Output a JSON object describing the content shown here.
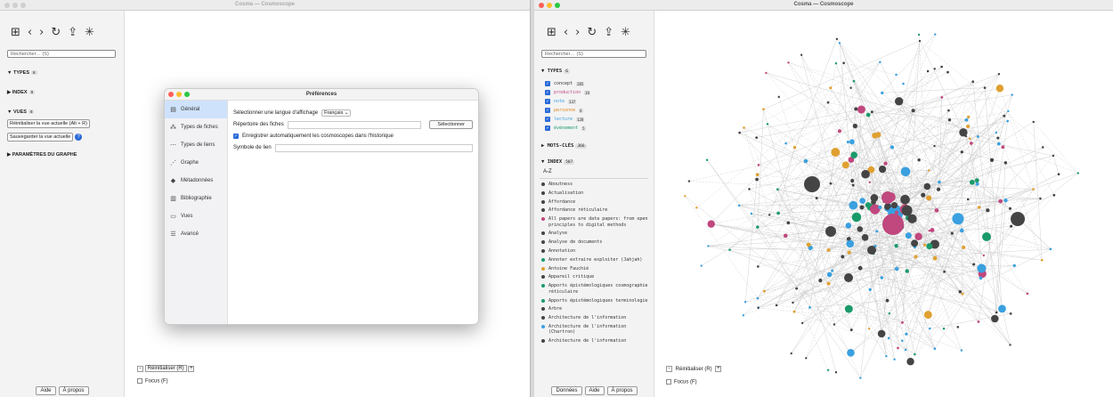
{
  "left_window": {
    "title": "Cosma — Cosmoscope",
    "toolbar_icons": [
      "new-record-icon",
      "back-icon",
      "forward-icon",
      "reload-icon",
      "share-icon",
      "asterisk-icon"
    ],
    "toolbar_glyphs": [
      "⊞",
      "‹",
      "›",
      "↻",
      "⇪",
      "✳"
    ],
    "search_placeholder": "Rechercher… (S)",
    "types_label": "TYPES",
    "types_badge": "8",
    "index_label": "INDEX",
    "index_badge": "8",
    "vues_label": "VUES",
    "vues_badge": "8",
    "reset_view_button": "Réinitialiser la vue actuelle (Alt + R)",
    "save_view_button": "Sauvegarder la vue actuelle",
    "help_mark": "?",
    "graph_params_label": "PARAMÈTRES DU GRAPHE",
    "zoom_minus": "-",
    "zoom_reset": "Réinitialiser (R)",
    "zoom_plus": "+",
    "focus_label": "Focus (F)",
    "help_button": "Aide",
    "about_button": "À propos"
  },
  "dialog": {
    "title": "Préférences",
    "nav": [
      {
        "label": "Général",
        "icon": "▤"
      },
      {
        "label": "Types de fiches",
        "icon": "⁂"
      },
      {
        "label": "Types de liens",
        "icon": "⋯"
      },
      {
        "label": "Graphe",
        "icon": "⋰"
      },
      {
        "label": "Métadonnées",
        "icon": "◆"
      },
      {
        "label": "Bibliographie",
        "icon": "▥"
      },
      {
        "label": "Vues",
        "icon": "▭"
      },
      {
        "label": "Avancé",
        "icon": "☰"
      }
    ],
    "language_label": "Sélectionner une langue d'affichage",
    "language_value": "Français",
    "repo_label": "Répertoire des fiches",
    "select_button": "Sélectionner",
    "autosave_label": "Enregistrer automatiquement les cosmoscopes dans l'historique",
    "link_symbol_label": "Symbole de lien"
  },
  "right_window": {
    "title": "Cosma — Cosmoscope",
    "search_placeholder": "Rechercher… (S)",
    "types_label": "TYPES",
    "types_badge": "6",
    "types": [
      {
        "name": "concept",
        "count": "285",
        "color": "#333333"
      },
      {
        "name": "production",
        "count": "19",
        "color": "#c0487e"
      },
      {
        "name": "note",
        "count": "137",
        "color": "#3aa0e0"
      },
      {
        "name": "personne",
        "count": "6",
        "color": "#e08a20"
      },
      {
        "name": "lecture",
        "count": "128",
        "color": "#3aa0e0"
      },
      {
        "name": "événement",
        "count": "5",
        "color": "#1a9a6a"
      }
    ],
    "keywords_label": "MOTS-CLÉS",
    "keywords_badge": "366",
    "index_label": "INDEX",
    "index_badge": "587",
    "az_label": "A-Z",
    "index_items": [
      {
        "label": "Aboutness",
        "color": "#444444"
      },
      {
        "label": "Actualisation",
        "color": "#444444"
      },
      {
        "label": "Affordance",
        "color": "#444444"
      },
      {
        "label": "Affordance réticulaire",
        "color": "#444444"
      },
      {
        "label": "All papers are data papers: from open principles to digital methods",
        "color": "#c0487e"
      },
      {
        "label": "Analyse",
        "color": "#444444"
      },
      {
        "label": "Analyse de documents",
        "color": "#444444"
      },
      {
        "label": "Annotation",
        "color": "#444444"
      },
      {
        "label": "Annoter extraire exploiter (Jahjah)",
        "color": "#1a9a6a"
      },
      {
        "label": "Antoine Fauchié",
        "color": "#e0a030"
      },
      {
        "label": "Appareil critique",
        "color": "#444444"
      },
      {
        "label": "Apports épistémologiques cosmographie réticulaire",
        "color": "#1a9a6a"
      },
      {
        "label": "Apports épistémologiques terminologie",
        "color": "#1a9a6a"
      },
      {
        "label": "Arbre",
        "color": "#444444"
      },
      {
        "label": "Architecture de l'information",
        "color": "#444444"
      },
      {
        "label": "Architecture de l'information (Chartron)",
        "color": "#3aa0e0"
      },
      {
        "label": "Architecture de l'information",
        "color": "#444444"
      }
    ],
    "zoom_minus": "-",
    "zoom_reset": "Réinitialiser (R)",
    "zoom_plus": "+",
    "focus_label": "Focus (F)",
    "data_button": "Données",
    "help_button": "Aide",
    "about_button": "À propos"
  }
}
